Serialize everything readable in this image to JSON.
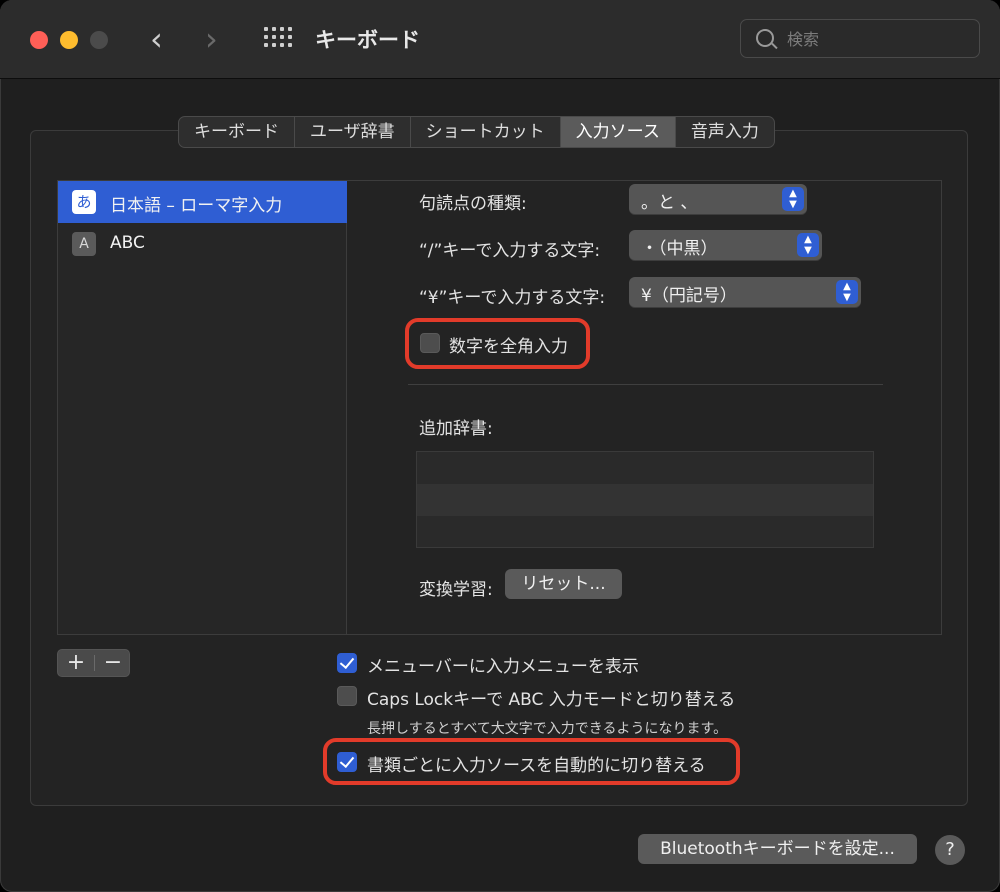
{
  "window": {
    "title": "キーボード",
    "search_placeholder": "検索"
  },
  "tabs": [
    {
      "label": "キーボード"
    },
    {
      "label": "ユーザ辞書"
    },
    {
      "label": "ショートカット"
    },
    {
      "label": "入力ソース",
      "selected": true
    },
    {
      "label": "音声入力"
    }
  ],
  "sources": [
    {
      "icon_text": "あ",
      "label": "日本語 – ローマ字入力",
      "selected": true
    },
    {
      "icon_text": "A",
      "label": "ABC"
    }
  ],
  "options": {
    "punctuation_label": "句読点の種類:",
    "punctuation_value": "。と 、",
    "slash_label": "“/”キーで入力する文字:",
    "slash_value": "・（中黒）",
    "yen_label": "“¥”キーで入力する文字:",
    "yen_value": "¥（円記号）",
    "fullwidth_numbers_label": "数字を全角入力",
    "fullwidth_numbers_checked": false,
    "additional_dict_label": "追加辞書:",
    "conversion_learning_label": "変換学習:",
    "reset_button": "リセット..."
  },
  "list_controls": {
    "add": "+",
    "remove": "−"
  },
  "bottom": {
    "menu_bar_label": "メニューバーに入力メニューを表示",
    "menu_bar_checked": true,
    "caps_lock_label": "Caps Lockキーで ABC 入力モードと切り替える",
    "caps_lock_checked": false,
    "caps_lock_note": "長押しするとすべて大文字で入力できるようになります。",
    "auto_switch_label": "書類ごとに入力ソースを自動的に切り替える",
    "auto_switch_checked": true,
    "bluetooth_button": "Bluetoothキーボードを設定...",
    "help": "?"
  },
  "colors": {
    "accent": "#2f5ed3",
    "highlight": "#e23b2a"
  }
}
